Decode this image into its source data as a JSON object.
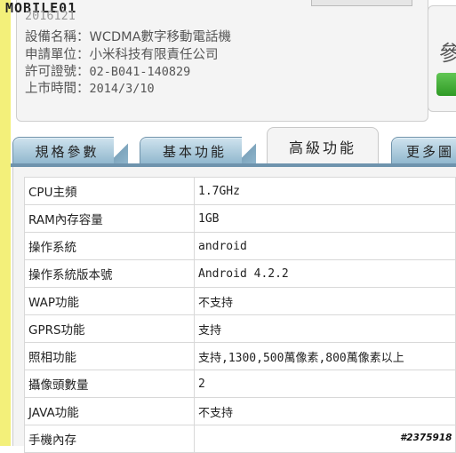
{
  "header": {
    "logo_text": "MOBILE01",
    "partial_date": "2016121"
  },
  "spec_info": [
    {
      "label": "設備名稱：",
      "value": "WCDMA數字移動電話機"
    },
    {
      "label": "申請單位：",
      "value": "小米科技有限責任公司"
    },
    {
      "label": "許可證號：",
      "value": "02-B041-140829"
    },
    {
      "label": "上市時間：",
      "value": "2014/3/10"
    }
  ],
  "side_panel": {
    "char": "參"
  },
  "tabs": [
    {
      "label": "規格參數",
      "active": false
    },
    {
      "label": "基本功能",
      "active": false
    },
    {
      "label": "高級功能",
      "active": true
    },
    {
      "label": "更多圖",
      "active": false
    }
  ],
  "table": {
    "rows": [
      {
        "label": "CPU主頻",
        "value": "1.7GHz"
      },
      {
        "label": "RAM內存容量",
        "value": "1GB"
      },
      {
        "label": "操作系統",
        "value": "android"
      },
      {
        "label": "操作系統版本號",
        "value": "Android 4.2.2"
      },
      {
        "label": "WAP功能",
        "value": "不支持"
      },
      {
        "label": "GPRS功能",
        "value": "支持"
      },
      {
        "label": "照相功能",
        "value": "支持,1300,500萬像素,800萬像素以上"
      },
      {
        "label": "攝像頭數量",
        "value": "2"
      },
      {
        "label": "JAVA功能",
        "value": "不支持"
      },
      {
        "label": "手機內存",
        "value": ""
      }
    ]
  },
  "watermark": "#2375918",
  "colors": {
    "tab_blue": "#8fb6cd",
    "tab_bar": "#6e93ad",
    "button_green": "#3aa52e"
  }
}
